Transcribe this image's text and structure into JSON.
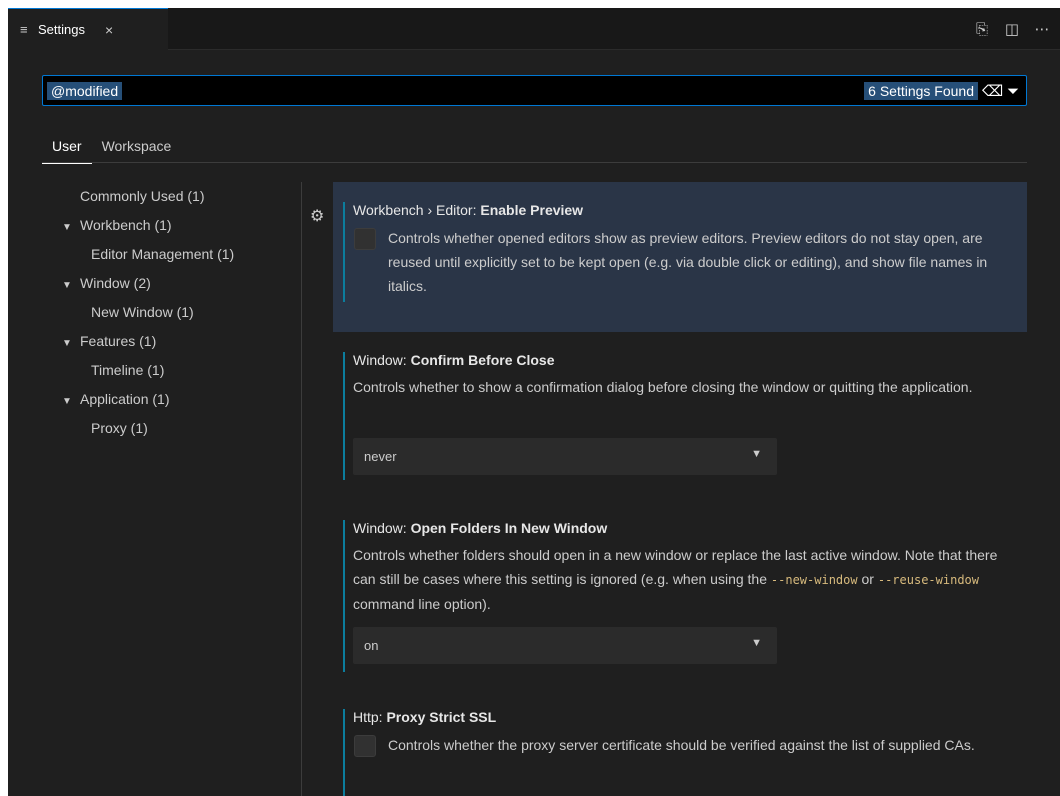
{
  "tab": {
    "icon": "settings-lines-icon",
    "label": "Settings",
    "close": "×"
  },
  "tab_actions": [
    {
      "name": "open-settings-json-icon",
      "glyph": "⎘"
    },
    {
      "name": "split-editor-icon",
      "glyph": "◫"
    },
    {
      "name": "more-actions-icon",
      "glyph": "⋯"
    }
  ],
  "search": {
    "value": "@modified",
    "result_count": "6 Settings Found",
    "clear_filter_icon": "clear-filter-icon",
    "filter_icon": "filter-icon"
  },
  "scope_tabs": [
    {
      "label": "User",
      "active": true
    },
    {
      "label": "Workspace",
      "active": false
    }
  ],
  "toc": [
    {
      "label": "Commonly Used (1)",
      "level": 0,
      "expandable": false
    },
    {
      "label": "Workbench (1)",
      "level": 0,
      "expandable": true
    },
    {
      "label": "Editor Management (1)",
      "level": 1,
      "expandable": false
    },
    {
      "label": "Window (2)",
      "level": 0,
      "expandable": true
    },
    {
      "label": "New Window (1)",
      "level": 1,
      "expandable": false
    },
    {
      "label": "Features (1)",
      "level": 0,
      "expandable": true
    },
    {
      "label": "Timeline (1)",
      "level": 1,
      "expandable": false
    },
    {
      "label": "Application (1)",
      "level": 0,
      "expandable": true
    },
    {
      "label": "Proxy (1)",
      "level": 1,
      "expandable": false
    }
  ],
  "settings": [
    {
      "category": "Workbench › Editor: ",
      "name": "Enable Preview",
      "type": "checkbox",
      "checked": false,
      "description": "Controls whether opened editors show as preview editors. Preview editors do not stay open, are reused until explicitly set to be kept open (e.g. via double click or editing), and show file names in italics."
    },
    {
      "category": "Window: ",
      "name": "Confirm Before Close",
      "type": "select",
      "description": "Controls whether to show a confirmation dialog before closing the window or quitting the application.",
      "value": "never"
    },
    {
      "category": "Window: ",
      "name": "Open Folders In New Window",
      "type": "select",
      "description_parts": [
        "Controls whether folders should open in a new window or replace the last active window. Note that there can still be cases where this setting is ignored (e.g. when using the ",
        "--new-window",
        " or ",
        "--reuse-window",
        " command line option)."
      ],
      "value": "on"
    },
    {
      "category": "Http: ",
      "name": "Proxy Strict SSL",
      "type": "checkbox",
      "checked": false,
      "description": "Controls whether the proxy server certificate should be verified against the list of supplied CAs."
    }
  ],
  "colors": {
    "accent": "#0078d4",
    "modified_indicator": "#0c7d9d",
    "focused_row": "#2a3547"
  }
}
